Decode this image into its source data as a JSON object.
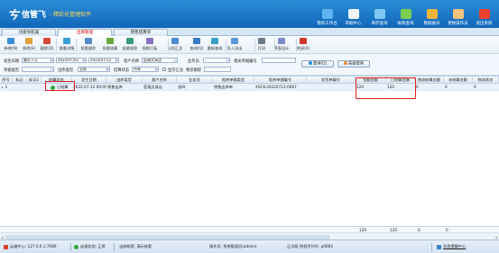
{
  "header": {
    "logo_mark": "ㄘ",
    "app_name": "信管飞",
    "slogan": "- 精彩化管理软件",
    "nav": [
      {
        "label": "我的工作台",
        "icon": "desktop-icon",
        "color": "#5fb3f0"
      },
      {
        "label": "单据中心",
        "icon": "document-center-icon",
        "color": "#f3f6fa"
      },
      {
        "label": "库存查询",
        "icon": "inventory-icon",
        "color": "#7dc9f2"
      },
      {
        "label": "帐款查询",
        "icon": "account-icon",
        "color": "#7bd050"
      },
      {
        "label": "数据备份",
        "icon": "backup-icon",
        "color": "#f0b43a"
      },
      {
        "label": "更换操作员",
        "icon": "user-switch-icon",
        "color": "#f5c27a"
      },
      {
        "label": "退出系统",
        "icon": "exit-icon",
        "color": "#e8412f"
      }
    ]
  },
  "tabs": [
    {
      "label": "功能导航器",
      "active": false
    },
    {
      "label": "出库管理",
      "active": true
    },
    {
      "label": "销售结算单",
      "active": false
    }
  ],
  "toolbar": [
    {
      "label": "新增(N)",
      "icon": "add-icon",
      "color": "#3b8fd8"
    },
    {
      "label": "修改(E)",
      "icon": "edit-icon",
      "color": "#e2a03a"
    },
    {
      "label": "删除(D)",
      "icon": "delete-icon",
      "color": "#d64a3a"
    },
    {
      "label": "查看详情",
      "icon": "view-details-icon",
      "color": "#3aa0d8"
    },
    {
      "label": "批量操作",
      "icon": "batch-icon",
      "color": "#5a88c6"
    },
    {
      "label": "批量结算",
      "icon": "settle-icon",
      "color": "#6aaa3a"
    },
    {
      "label": "批量收款",
      "icon": "receive-icon",
      "color": "#3a9a7a"
    },
    {
      "label": "规格打板",
      "icon": "spec-icon",
      "color": "#8a70c0"
    },
    {
      "label": "分组汇总",
      "icon": "group-summary-icon",
      "color": "#4a8ad0"
    },
    {
      "label": "查询(Q)",
      "icon": "query-icon",
      "color": "#3a7ac0"
    },
    {
      "label": "重新查询",
      "icon": "requery-icon",
      "color": "#3aa0c8"
    },
    {
      "label": "导入导出",
      "icon": "import-export-icon",
      "color": "#5a9ad8"
    },
    {
      "label": "打印",
      "icon": "print-icon",
      "color": "#6a7a8a"
    },
    {
      "label": "界面设计",
      "icon": "layout-design-icon",
      "color": "#7a8ac8"
    },
    {
      "label": "关闭(X)",
      "icon": "close-icon",
      "color": "#d0382a"
    }
  ],
  "filters": {
    "date_label": "发生日期",
    "date_range": "最近十天",
    "date_from": "2022/07/02",
    "date_to": "2022/07/12",
    "customer_label": "客户名称",
    "customer_value": "蓝福文具店",
    "salesman_label": "业务员",
    "salesman_value": "",
    "related_no_label": "相关单据编号",
    "related_no_value": "",
    "doc_type_label": "单据类型",
    "doc_type_value": "",
    "outbound_type_label": "出库类型",
    "outbound_type_value": "全部",
    "settle_status_label": "结算状态",
    "settle_status_value": "所有",
    "show_summary_label": "显示汇总",
    "logistics_label": "物流跟踪",
    "logistics_value": "",
    "query_button": "查询(Q)",
    "advanced_button": "高级查询"
  },
  "grid": {
    "columns": [
      "序号",
      "标记",
      "标记2",
      "结算状态",
      "发生日期",
      "出库类型",
      "客户名称",
      "业务员",
      "相关单据类型",
      "相关单据编号",
      "发货单编号",
      "金额金额",
      "已结算金额",
      "物流结算金额",
      "未结算金额",
      "物流状态"
    ],
    "rows": [
      {
        "index": "1",
        "mark": "",
        "status": "已结算",
        "date": "2022-07-12 00:00",
        "type": "销售出库",
        "customer": "蓝福文具店",
        "salesman": "张四",
        "related_type": "销售出库单",
        "related_no": "XSCK-20220712-0087",
        "shipping_no": "",
        "amount": "120",
        "settled": "120",
        "logistics_amount": "0",
        "unsettled": "0",
        "logistics_status": "0"
      }
    ],
    "footer": {
      "amount": "120",
      "settled": "120",
      "logistics_amount": "0",
      "unsettled": "0"
    }
  },
  "statusbar": {
    "center_label": "云端中心: 127.0.0.1:7089",
    "connection_label": "连接状态: 正常",
    "company_label": "当前帐套: 演示帐套",
    "operator_label": "操作员: 系统管理员(admin)",
    "version_label": "正式版  授权序列号: p0083",
    "message_center": "消息提醒中心"
  }
}
